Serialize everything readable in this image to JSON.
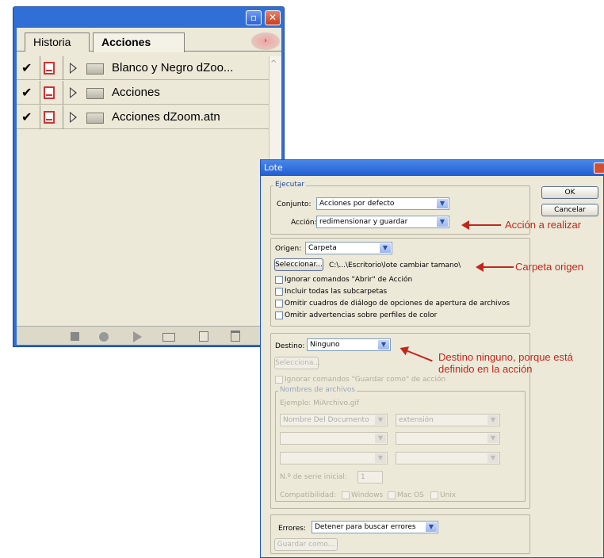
{
  "panel": {
    "tabs": [
      "Historia",
      "Acciones"
    ],
    "items": [
      {
        "checked": true,
        "label": "Blanco y Negro dZoo..."
      },
      {
        "checked": true,
        "label": "Acciones"
      },
      {
        "checked": true,
        "label": "Acciones dZoom.atn"
      }
    ],
    "check_glyph": "✔",
    "scroll_up_glyph": "^",
    "menu_glyph": "›",
    "min_glyph": "▫",
    "close_glyph": "✕"
  },
  "dialog": {
    "title": "Lote",
    "ejecutar": {
      "label": "Ejecutar",
      "conjunto_label": "Conjunto:",
      "conjunto_value": "Acciones por defecto",
      "accion_label": "Acción:",
      "accion_value": "redimensionar y guardar"
    },
    "buttons": {
      "ok": "OK",
      "cancel": "Cancelar"
    },
    "origen": {
      "label": "Origen:",
      "value": "Carpeta",
      "select_button": "Seleccionar...",
      "path": "C:\\...\\Escritorio\\lote cambiar tamano\\",
      "options": [
        "Ignorar comandos \"Abrir\" de Acción",
        "Incluir todas las subcarpetas",
        "Omitir cuadros de diálogo de opciones de apertura de archivos",
        "Omitir advertencias sobre perfiles de color"
      ]
    },
    "destino": {
      "label": "Destino:",
      "value": "Ninguno",
      "select_button": "Selecciona...",
      "override": "Ignorar comandos \"Guardar como\" de acción",
      "names_group": "Nombres de archivos",
      "example": "Ejemplo: MiArchivo.gif",
      "row1_left": "Nombre Del Documento",
      "row1_right": "extensión",
      "serial_label": "N.º de serie inicial:",
      "serial_value": "1",
      "compat_label": "Compatibilidad:",
      "compat_options": [
        "Windows",
        "Mac OS",
        "Unix"
      ]
    },
    "errores": {
      "label": "Errores:",
      "value": "Detener para buscar errores",
      "save_button": "Guardar como..."
    }
  },
  "annotations": {
    "accion": "Acción a realizar",
    "carpeta": "Carpeta origen",
    "destino_line1": "Destino ninguno, porque está",
    "destino_line2": "definido en la acción"
  },
  "colors": {
    "annotation": "#c3261c",
    "xp_blue": "#2f6fd6"
  }
}
